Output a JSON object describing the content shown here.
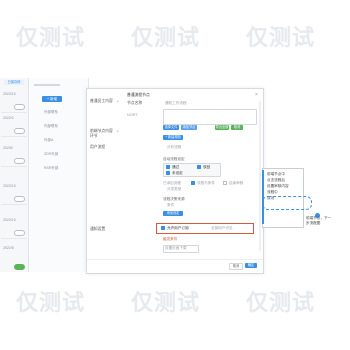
{
  "watermark": "仅测试",
  "left_list": {
    "tab": "已保存网",
    "rows": [
      "2022/10",
      "2022/2",
      "20200",
      "2022/10",
      "2022/10",
      "2022/5"
    ]
  },
  "tree": {
    "add_label": "+ 新增",
    "items": [
      "外部联系",
      "内部联系",
      "外部A",
      "ZDR外部",
      "RSR外部"
    ]
  },
  "dialog": {
    "title": "普通流程节点",
    "row1_label": "普通员工内容",
    "row2_label": "前端节点内容环节",
    "field_name_label": "节点名称",
    "field_name_value": "通知工作流程",
    "field_type_label": "NORT",
    "buttons": [
      "选择文件",
      "添加节点",
      "导出全部",
      "取消"
    ],
    "user_label": "用户流程",
    "list_header": "分析流程",
    "add_btn": "+ 新建规则",
    "auto_label": "已添加流程",
    "option_label": "自动流程设定",
    "checks": [
      "通过",
      "驳回",
      "未设定"
    ],
    "extra_options": [
      "流程与条件",
      "分发类型",
      "结束审核"
    ],
    "sub_header": "流程决策来源",
    "sub_list": "条件",
    "sub_btn": "添加设定",
    "group_label": "通知设置",
    "highlight_option": "允许用户订阅",
    "highlight_value": "全部用户可见",
    "below_highlight": "触发条件",
    "select_label": "设置页面下载",
    "footer_cancel": "取消",
    "footer_ok": "确定"
  },
  "tooltip": {
    "lines": [
      "前端节点中",
      "点击流程后",
      "设置审核内容",
      "流程中",
      "成功"
    ],
    "side_note": "前端节点，下一步流程图"
  },
  "colors": {
    "accent": "#3a8ee6",
    "highlight_border": "#d65a3c",
    "toggle_on": "#5ab45a"
  }
}
